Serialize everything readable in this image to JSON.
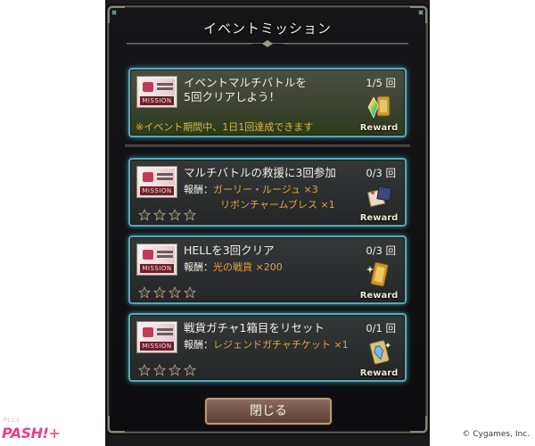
{
  "dialog": {
    "title": "イベントミッション",
    "close_label": "閉じる"
  },
  "missions": [
    {
      "thumb_label": "MISSION",
      "title": "イベントマルチバトルを\n5回クリアしよう！",
      "count": "1/5 回",
      "note": "※イベント期間中、1日1回達成できます",
      "reward_label": "Reward",
      "reward_icon": "rainbow-crystal-and-ticket-icon"
    },
    {
      "thumb_label": "MISSION",
      "title": "マルチバトルの救援に3回参加",
      "count": "0/3 回",
      "reward_key": "報酬：",
      "reward_value": "ガーリー・ルージュ ×3",
      "reward_value2": "リボンチャームブレス ×1",
      "reward_label": "Reward",
      "reward_icon": "outfit-items-icon",
      "stars": 0
    },
    {
      "thumb_label": "MISSION",
      "title": "HELLを3回クリア",
      "count": "0/3 回",
      "reward_key": "報酬：",
      "reward_value": "光の戦貨 ×200",
      "reward_label": "Reward",
      "reward_icon": "gold-card-icon",
      "stars": 0
    },
    {
      "thumb_label": "MISSION",
      "title": "戦貨ガチャ1箱目をリセット",
      "count": "0/1 回",
      "reward_key": "報酬：",
      "reward_value": "レジェンドガチャチケット ×1",
      "reward_label": "Reward",
      "reward_icon": "legend-ticket-icon",
      "stars": 0
    }
  ],
  "footer": {
    "brand": "PASH!",
    "brand_plus": "+",
    "brand_sub": "PLUS",
    "copyright": "© Cygames, Inc."
  },
  "colors": {
    "frame_glow": "#57a9b7",
    "reward_text": "#e7a43a",
    "note_text": "#d7b84a",
    "brand_pink": "#e8408e"
  }
}
